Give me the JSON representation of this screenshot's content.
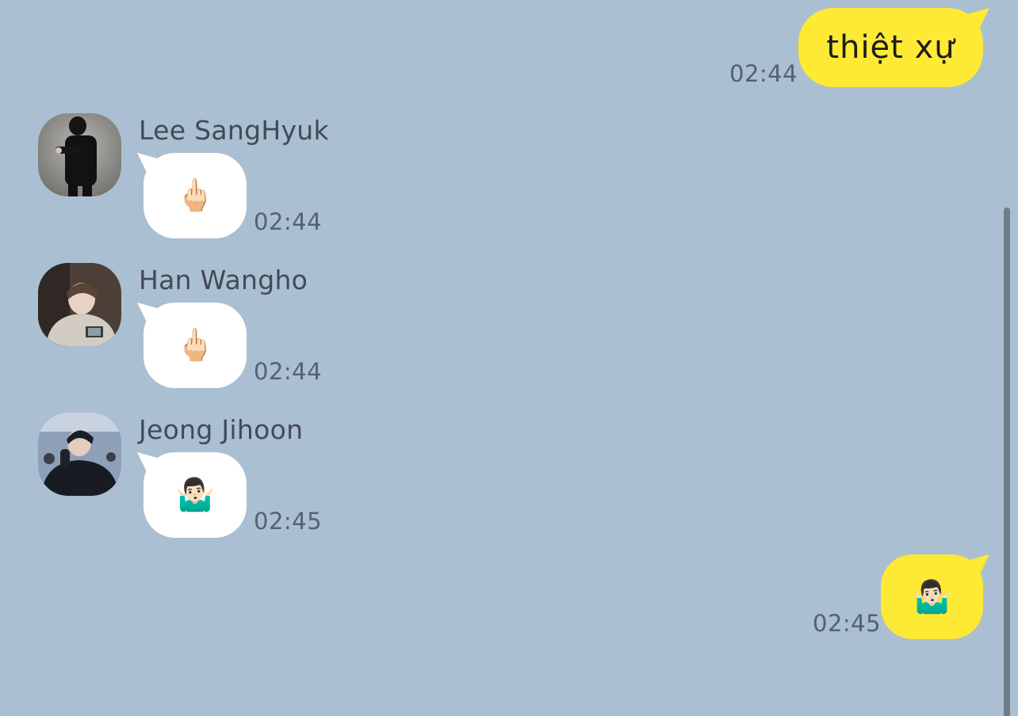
{
  "colors": {
    "background": "#aabfd1",
    "outgoing_bubble": "#fee934",
    "incoming_bubble": "#ffffff",
    "timestamp": "#556170",
    "sender_name": "#434a55"
  },
  "messages": [
    {
      "direction": "outgoing",
      "text": "thiệt xự",
      "time": "02:44"
    },
    {
      "direction": "incoming",
      "sender": "Lee SangHyuk",
      "avatar_icon": "profile-photo-dark-outfit",
      "emoji": "🖕🏻",
      "time": "02:44"
    },
    {
      "direction": "incoming",
      "sender": "Han Wangho",
      "avatar_icon": "profile-photo-grey-hoodie",
      "emoji": "🖕🏻",
      "time": "02:44"
    },
    {
      "direction": "incoming",
      "sender": "Jeong Jihoon",
      "avatar_icon": "profile-photo-black-jacket",
      "emoji": "🤷🏻‍♂️",
      "time": "02:45"
    },
    {
      "direction": "outgoing",
      "emoji": "🤷🏻‍♂️",
      "time": "02:45"
    }
  ]
}
